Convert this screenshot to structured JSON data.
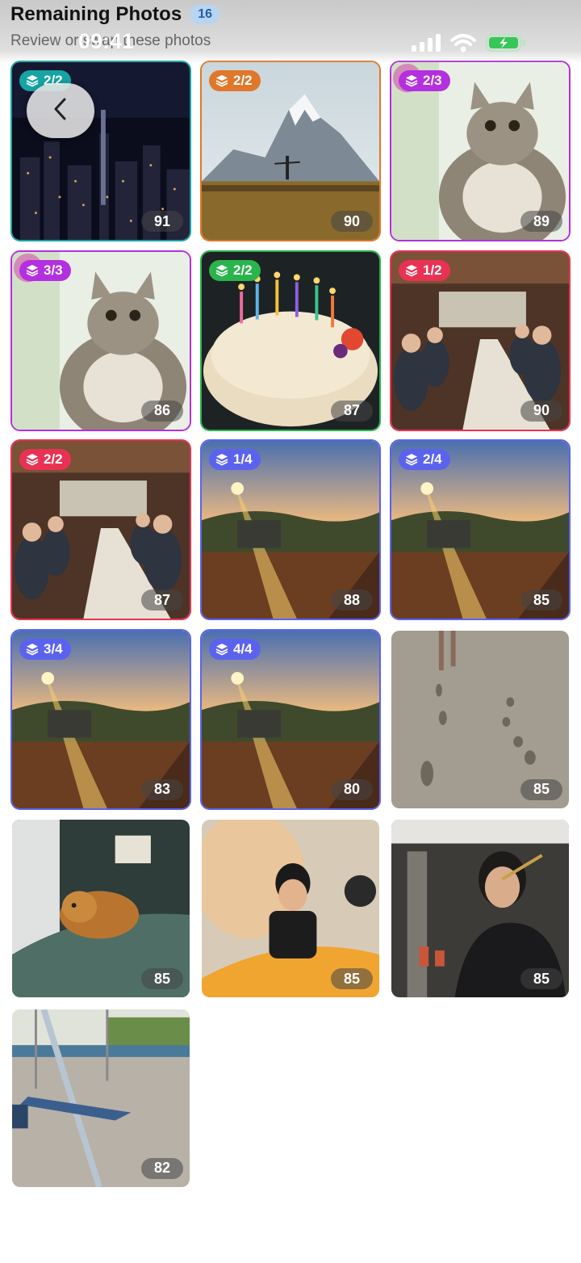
{
  "status_bar": {
    "time": "09:41"
  },
  "header": {
    "title": "Remaining Photos",
    "count": "16",
    "subtitle": "Review or swap these photos"
  },
  "colors": {
    "teal": "#16a4a4",
    "orange": "#e0772a",
    "purple": "#b42fe0",
    "green": "#29b44c",
    "red": "#e93253",
    "indigo": "#5b63ee",
    "battery": "#37c759"
  },
  "photos": [
    {
      "badge": "2/2",
      "badge_color": "#16a4a4",
      "score": "91",
      "scene": "city-night"
    },
    {
      "badge": "2/2",
      "badge_color": "#e0772a",
      "score": "90",
      "scene": "mountain"
    },
    {
      "badge": "2/3",
      "badge_color": "#b42fe0",
      "score": "89",
      "scene": "cat"
    },
    {
      "badge": "3/3",
      "badge_color": "#b42fe0",
      "score": "86",
      "scene": "cat"
    },
    {
      "badge": "2/2",
      "badge_color": "#29b44c",
      "score": "87",
      "scene": "cake"
    },
    {
      "badge": "1/2",
      "badge_color": "#e93253",
      "score": "90",
      "scene": "dinner"
    },
    {
      "badge": "2/2",
      "badge_color": "#e93253",
      "score": "87",
      "scene": "dinner"
    },
    {
      "badge": "1/4",
      "badge_color": "#5b63ee",
      "score": "88",
      "scene": "sunset"
    },
    {
      "badge": "2/4",
      "badge_color": "#5b63ee",
      "score": "85",
      "scene": "sunset"
    },
    {
      "badge": "3/4",
      "badge_color": "#5b63ee",
      "score": "83",
      "scene": "sunset"
    },
    {
      "badge": "4/4",
      "badge_color": "#5b63ee",
      "score": "80",
      "scene": "sunset"
    },
    {
      "badge": "",
      "badge_color": "",
      "score": "85",
      "scene": "sand"
    },
    {
      "badge": "",
      "badge_color": "",
      "score": "85",
      "scene": "dog"
    },
    {
      "badge": "",
      "badge_color": "",
      "score": "85",
      "scene": "child"
    },
    {
      "badge": "",
      "badge_color": "",
      "score": "85",
      "scene": "woman"
    },
    {
      "badge": "",
      "badge_color": "",
      "score": "82",
      "scene": "swing"
    }
  ]
}
